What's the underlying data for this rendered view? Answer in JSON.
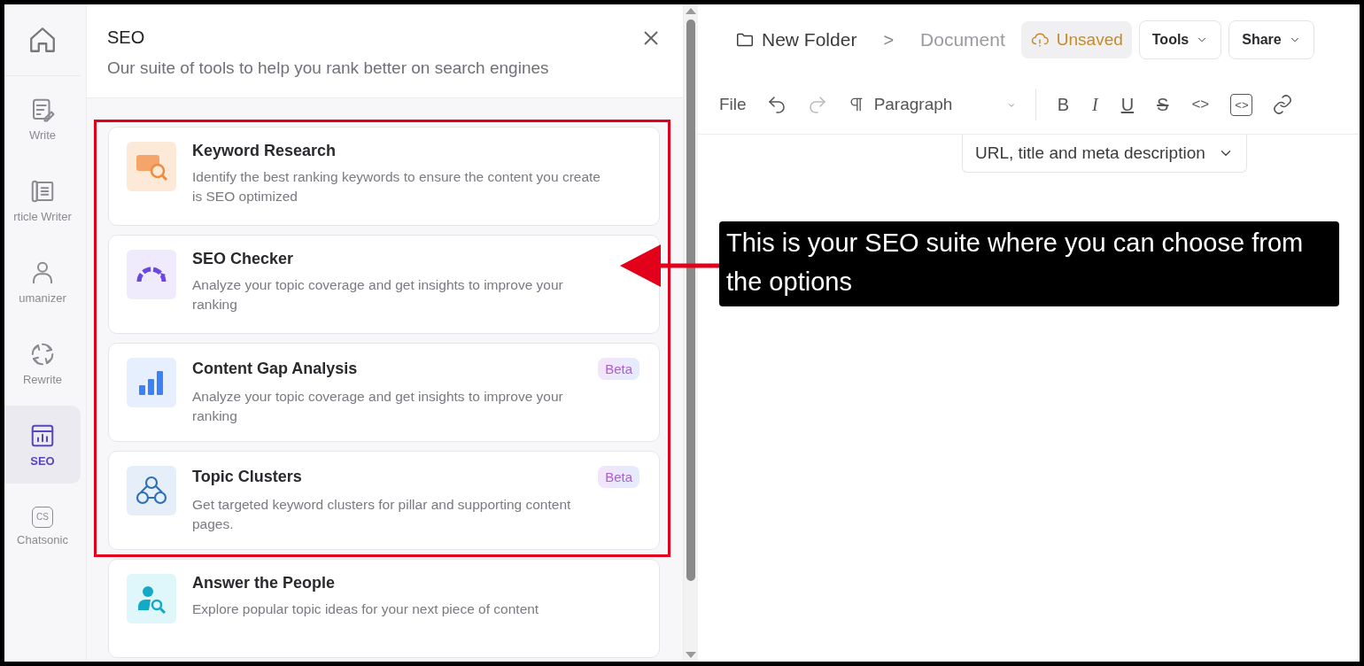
{
  "sidebar": {
    "items": [
      {
        "kind": "write",
        "label": "Write",
        "selected": false
      },
      {
        "kind": "article",
        "label": "rticle Writer",
        "selected": false
      },
      {
        "kind": "humanizer",
        "label": "umanizer",
        "selected": false
      },
      {
        "kind": "rewrite",
        "label": "Rewrite",
        "selected": false
      },
      {
        "kind": "seo",
        "label": "SEO",
        "selected": true
      },
      {
        "kind": "chatsonic",
        "label": "Chatsonic",
        "icon_text": "CS",
        "selected": false
      }
    ]
  },
  "panel": {
    "title": "SEO",
    "subtitle": "Our suite of tools to help you rank better on search engines",
    "tools": [
      {
        "kind": "keyword",
        "title": "Keyword Research",
        "description": "Identify the best ranking keywords to ensure the content you create is SEO optimized",
        "highlighted": true
      },
      {
        "kind": "checker",
        "title": "SEO Checker",
        "description": "Analyze your topic coverage and get insights to improve your ranking",
        "highlighted": true
      },
      {
        "kind": "gap",
        "title": "Content Gap Analysis",
        "badge": "Beta",
        "description": "Analyze your topic coverage and get insights to improve your ranking",
        "highlighted": true
      },
      {
        "kind": "clusters",
        "title": "Topic Clusters",
        "badge": "Beta",
        "description": "Get targeted keyword clusters for pillar and supporting content pages.",
        "highlighted": true
      },
      {
        "kind": "people",
        "title": "Answer the People",
        "description": "Explore popular topic ideas for your next piece of content",
        "highlighted": false
      }
    ]
  },
  "editor": {
    "breadcrumb": {
      "folder": "New Folder",
      "separator": ">",
      "document": "Document"
    },
    "save_status": "Unsaved",
    "buttons": [
      "Tools",
      "Share"
    ],
    "toolbar": {
      "file": "File",
      "block_style": "Paragraph",
      "format_buttons": [
        {
          "kind": "bold",
          "label": "B"
        },
        {
          "kind": "italic",
          "label": "I"
        },
        {
          "kind": "underline",
          "label": "U"
        },
        {
          "kind": "strike",
          "label": "S"
        },
        {
          "kind": "code",
          "label": "<>"
        },
        {
          "kind": "codeblock",
          "label": "<>"
        }
      ]
    },
    "seo_dropdown": "URL, title and meta description"
  },
  "callout": {
    "text": "This is your SEO suite where you can choose from the options"
  }
}
